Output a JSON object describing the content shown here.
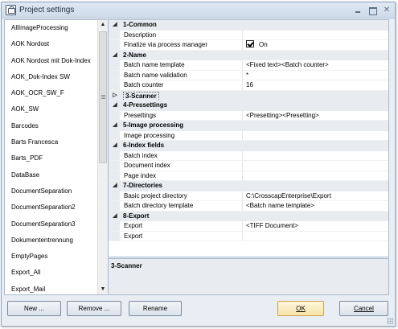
{
  "window": {
    "title": "Project settings"
  },
  "left_list": {
    "items": [
      "AllImageProcessing",
      "AOK Nordost",
      "AOK Nordost mit Dok-Index",
      "AOK_Dok-Index SW",
      "AOK_OCR_SW_F",
      "AOK_SW",
      "Barcodes",
      "Barts Francesca",
      "Barts_PDF",
      "DataBase",
      "DocumentSeparation",
      "DocumentSeparation2",
      "DocumentSeparation3",
      "Dokumententrennung",
      "EmptyPages",
      "Export_All",
      "Export_Mail"
    ]
  },
  "grid": {
    "rows": [
      {
        "kind": "cat",
        "expander": "◢",
        "label": "1-Common"
      },
      {
        "kind": "prop",
        "name": "Description",
        "value": ""
      },
      {
        "kind": "prop",
        "name": "Finalize via process manager",
        "value": "On",
        "checkbox": true
      },
      {
        "kind": "cat",
        "expander": "◢",
        "label": "2-Name"
      },
      {
        "kind": "prop",
        "name": "Batch name template",
        "value": "<Fixed text><Batch counter>"
      },
      {
        "kind": "prop",
        "name": "Batch name validation",
        "value": "*"
      },
      {
        "kind": "prop",
        "name": "Batch counter",
        "value": "16"
      },
      {
        "kind": "cat",
        "expander": "▷",
        "label": "3-Scanner",
        "selected": true
      },
      {
        "kind": "cat",
        "expander": "◢",
        "label": "4-Pressettings"
      },
      {
        "kind": "prop",
        "name": "Presettings",
        "value": "<Presetting><Presetting>"
      },
      {
        "kind": "cat",
        "expander": "◢",
        "label": "5-Image processing"
      },
      {
        "kind": "prop",
        "name": "Image processing",
        "value": ""
      },
      {
        "kind": "cat",
        "expander": "◢",
        "label": "6-Index fields"
      },
      {
        "kind": "prop",
        "name": "Batch index",
        "value": ""
      },
      {
        "kind": "prop",
        "name": "Document index",
        "value": ""
      },
      {
        "kind": "prop",
        "name": "Page index",
        "value": ""
      },
      {
        "kind": "cat",
        "expander": "◢",
        "label": "7-Directories"
      },
      {
        "kind": "prop",
        "name": "Basic project directory",
        "value": "C:\\CrosscapEnterprise\\Export"
      },
      {
        "kind": "prop",
        "name": "Batch directory template",
        "value": "<Batch name template>"
      },
      {
        "kind": "cat",
        "expander": "◢",
        "label": "8-Export"
      },
      {
        "kind": "prop",
        "name": "Export",
        "value": "<TIFF Document>"
      },
      {
        "kind": "prop",
        "name": "Export",
        "value": ""
      }
    ]
  },
  "description": {
    "title": "3-Scanner"
  },
  "buttons": {
    "new": "New ...",
    "remove": "Remove ...",
    "rename": "Rename",
    "ok": "OK",
    "cancel": "Cancel"
  },
  "icons": {
    "app": "settings-window-icon",
    "minimize": "minimize-icon",
    "maximize": "maximize-icon",
    "close": "close-icon",
    "scroll_up": "scroll-up-arrow-icon",
    "scroll_down": "scroll-down-arrow-icon"
  }
}
